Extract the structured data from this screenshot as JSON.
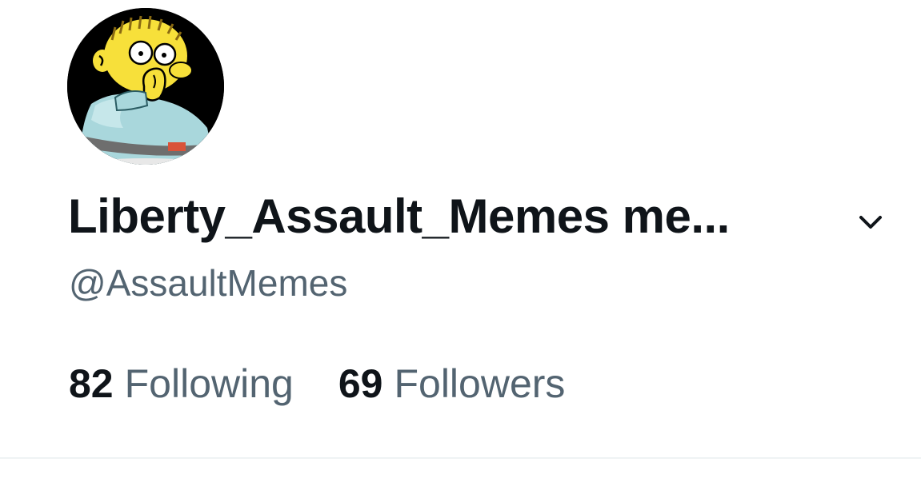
{
  "profile": {
    "display_name": "Liberty_Assault_Memes me...",
    "handle": "@AssaultMemes",
    "avatar_icon": "cartoon-boy-avatar"
  },
  "stats": {
    "following_count": "82",
    "following_label": "Following",
    "followers_count": "69",
    "followers_label": "Followers"
  },
  "icons": {
    "account_switcher": "chevron-down-icon"
  },
  "colors": {
    "primary_text": "#0f1419",
    "secondary_text": "#536471",
    "divider": "#eff3f4",
    "background": "#ffffff"
  }
}
